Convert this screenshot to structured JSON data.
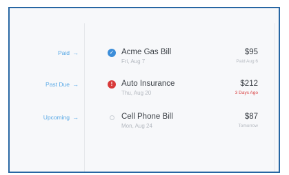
{
  "bills": [
    {
      "status_label": "Paid",
      "status_icon": "check-icon",
      "name": "Acme Gas Bill",
      "date": "Fri, Aug 7",
      "amount": "$95",
      "note": "Paid Aug 6"
    },
    {
      "status_label": "Past Due",
      "status_icon": "alert-icon",
      "name": "Auto Insurance",
      "date": "Thu, Aug 20",
      "amount": "$212",
      "note": "3 Days Ago"
    },
    {
      "status_label": "Upcoming",
      "status_icon": "empty-circle-icon",
      "name": "Cell Phone Bill",
      "date": "Mon, Aug 24",
      "amount": "$87",
      "note": "Tomorrow"
    }
  ],
  "colors": {
    "frame_border": "#2766a3",
    "status_text": "#5aa9e6",
    "paid_dot": "#3d8ed9",
    "past_due": "#d83a3a"
  }
}
